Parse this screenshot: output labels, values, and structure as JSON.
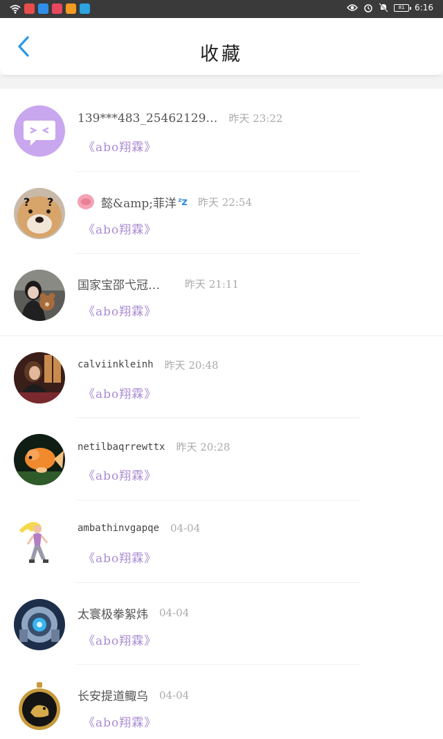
{
  "status_bar": {
    "time": "6:16",
    "battery": "81",
    "app_icon_colors": [
      "#e84d4d",
      "#2e8ee8",
      "#e8485f",
      "#f29a22",
      "#2ba4e0"
    ]
  },
  "header": {
    "title": "收藏",
    "accent_color": "#2d9ae8"
  },
  "colors": {
    "book_title": "#a98bd1",
    "time_text": "#aaaaaa",
    "name_text": "#555555",
    "background_gap": "#f3f3f4"
  },
  "favorites": [
    {
      "name": "139***483_25462129…",
      "time": "昨天 23:22",
      "book": "《abo翔霖》",
      "avatar": "chat-bubble-avatar"
    },
    {
      "name": "懿&amp;菲洋",
      "time": "昨天 22:54",
      "book": "《abo翔霖》",
      "avatar": "dog-avatar"
    },
    {
      "name": "国家宝邵弋冠…",
      "time": "昨天 21:11",
      "book": "《abo翔霖》",
      "avatar": "girl-with-bear-avatar"
    },
    {
      "name": "calviinkleinh",
      "time": "昨天 20:48",
      "book": "《abo翔霖》",
      "avatar": "woman-portrait-avatar"
    },
    {
      "name": "netilbaqrrewttx",
      "time": "昨天 20:28",
      "book": "《abo翔霖》",
      "avatar": "goldfish-avatar"
    },
    {
      "name": "ambathinvgapqe",
      "time": "04-04",
      "book": "《abo翔霖》",
      "avatar": "cartoon-girl-avatar"
    },
    {
      "name": "太寰极拳絮炜",
      "time": "04-04",
      "book": "《abo翔霖》",
      "avatar": "robot-avatar"
    },
    {
      "name": "长安提道鲰乌",
      "time": "04-04",
      "book": "《abo翔霖》",
      "avatar": "pocket-watch-avatar"
    }
  ]
}
